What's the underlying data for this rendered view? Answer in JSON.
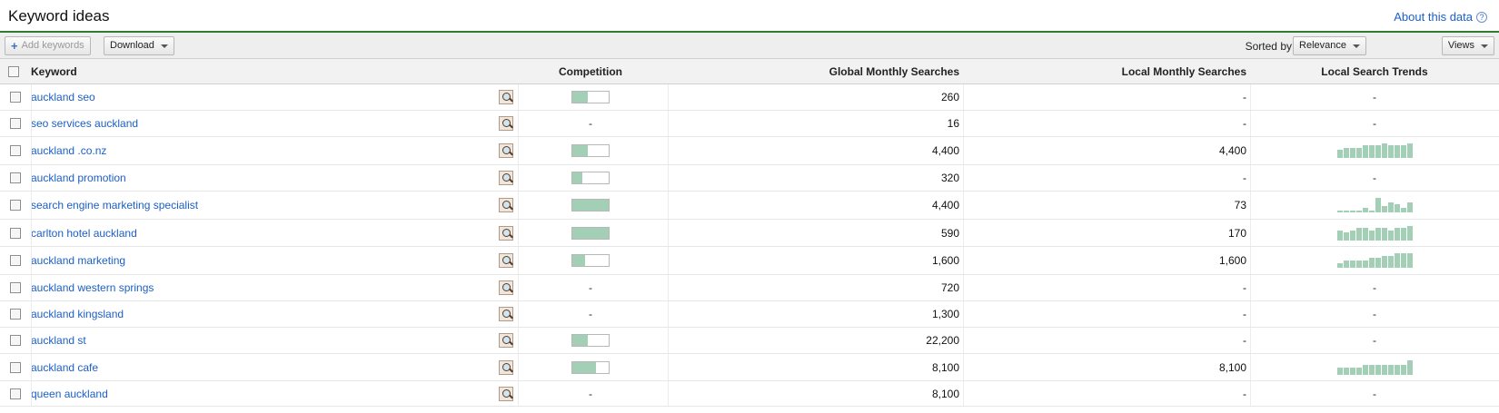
{
  "header": {
    "title": "Keyword ideas",
    "about_label": "About this data",
    "about_icon": "help-question-icon"
  },
  "toolbar": {
    "add_keywords_label": "Add keywords",
    "download_label": "Download",
    "sorted_by_label": "Sorted by",
    "sort_value": "Relevance",
    "views_label": "Views"
  },
  "columns": {
    "keyword": "Keyword",
    "competition": "Competition",
    "global": "Global Monthly Searches",
    "local": "Local Monthly Searches",
    "trends": "Local Search Trends"
  },
  "colors": {
    "accent_green": "#2e7d32",
    "bar_fill": "#a3cfb7",
    "link_blue": "#1c5fc7"
  },
  "rows": [
    {
      "keyword": "auckland seo",
      "competition": 0.42,
      "competition_text": null,
      "global": "260",
      "local": "-",
      "trend": null
    },
    {
      "keyword": "seo services auckland",
      "competition": null,
      "competition_text": "-",
      "global": "16",
      "local": "-",
      "trend": null
    },
    {
      "keyword": "auckland .co.nz",
      "competition": 0.42,
      "competition_text": null,
      "global": "4,400",
      "local": "4,400",
      "trend": [
        4,
        5,
        5,
        5,
        6,
        6,
        6,
        7,
        6,
        6,
        6,
        7
      ]
    },
    {
      "keyword": "auckland promotion",
      "competition": 0.28,
      "competition_text": null,
      "global": "320",
      "local": "-",
      "trend": null
    },
    {
      "keyword": "search engine marketing specialist",
      "competition": 1.0,
      "competition_text": null,
      "global": "4,400",
      "local": "73",
      "trend": [
        1,
        1,
        1,
        1,
        2,
        1,
        7,
        3,
        5,
        4,
        2,
        5
      ]
    },
    {
      "keyword": "carlton hotel auckland",
      "competition": 1.0,
      "competition_text": null,
      "global": "590",
      "local": "170",
      "trend": [
        5,
        4,
        5,
        6,
        6,
        5,
        6,
        6,
        5,
        6,
        6,
        7
      ]
    },
    {
      "keyword": "auckland marketing",
      "competition": 0.35,
      "competition_text": null,
      "global": "1,600",
      "local": "1,600",
      "trend": [
        2,
        3,
        3,
        3,
        3,
        4,
        4,
        5,
        5,
        6,
        6,
        6
      ]
    },
    {
      "keyword": "auckland western springs",
      "competition": null,
      "competition_text": "-",
      "global": "720",
      "local": "-",
      "trend": null
    },
    {
      "keyword": "auckland kingsland",
      "competition": null,
      "competition_text": "-",
      "global": "1,300",
      "local": "-",
      "trend": null
    },
    {
      "keyword": "auckland st",
      "competition": 0.42,
      "competition_text": null,
      "global": "22,200",
      "local": "-",
      "trend": null
    },
    {
      "keyword": "auckland cafe",
      "competition": 0.65,
      "competition_text": null,
      "global": "8,100",
      "local": "8,100",
      "trend": [
        3,
        3,
        3,
        3,
        4,
        4,
        4,
        4,
        4,
        4,
        4,
        6
      ]
    },
    {
      "keyword": "queen auckland",
      "competition": null,
      "competition_text": "-",
      "global": "8,100",
      "local": "-",
      "trend": null
    }
  ]
}
